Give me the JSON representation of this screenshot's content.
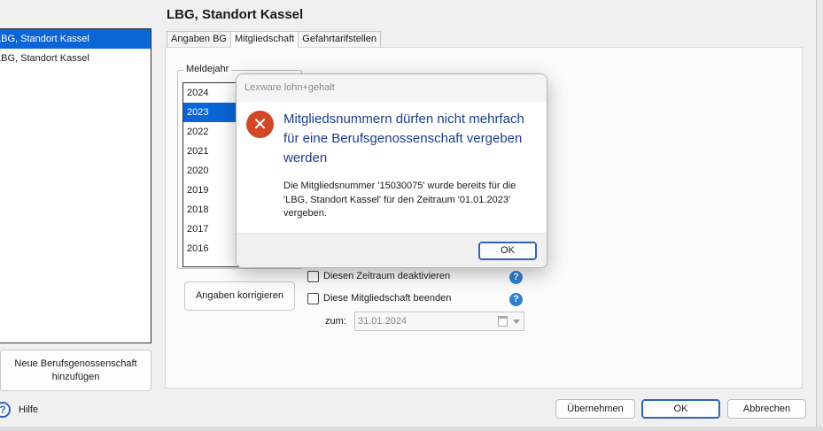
{
  "left_list": {
    "items": [
      {
        "label": "LBG, Standort Kassel",
        "selected": true
      },
      {
        "label": "LBG, Standort Kassel",
        "selected": false
      }
    ]
  },
  "add_button_label": "Neue Berufsgenossenschaft hinzufügen",
  "help_label": "Hilfe",
  "page_title": "LBG, Standort Kassel",
  "tabs": [
    {
      "label": "Angaben BG",
      "active": false
    },
    {
      "label": "Mitgliedschaft",
      "active": true
    },
    {
      "label": "Gefahrtarifstellen",
      "active": false
    }
  ],
  "meldejahr": {
    "label": "Meldejahr",
    "years": [
      "2024",
      "2023",
      "2022",
      "2021",
      "2020",
      "2019",
      "2018",
      "2017",
      "2016"
    ],
    "selected": "2023"
  },
  "korrigieren_label": "Angaben korrigieren",
  "checkboxes": {
    "deaktivieren": "Diesen Zeitraum deaktivieren",
    "beenden": "Diese Mitgliedschaft beenden"
  },
  "zum_label": "zum:",
  "zum_date": "31.01.2024",
  "buttons": {
    "uebernehmen": "Übernehmen",
    "ok": "OK",
    "abbrechen": "Abbrechen"
  },
  "dialog": {
    "title": "Lexware lohn+gehalt",
    "heading": "Mitgliedsnummern dürfen nicht mehrfach für eine Berufsgenossenschaft vergeben werden",
    "body": "Die Mitgliedsnummer '15030075' wurde bereits für die 'LBG, Standort Kassel' für den Zeitraum '01.01.2023' vergeben.",
    "ok": "OK"
  },
  "colors": {
    "selection": "#0a66d6",
    "error": "#d24726",
    "heading": "#1c3d8c",
    "info": "#2e7fd0"
  },
  "icons": {
    "error": "error-circle-icon",
    "help": "help-icon",
    "question": "question-icon",
    "calendar": "calendar-icon"
  }
}
